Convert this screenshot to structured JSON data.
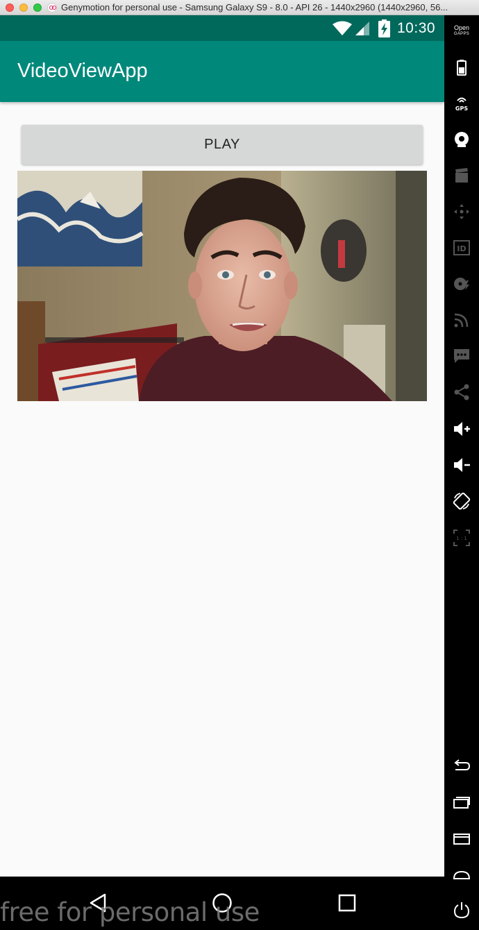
{
  "window": {
    "title": "Genymotion for personal use - Samsung Galaxy S9 - 8.0 - API 26 - 1440x2960 (1440x2960, 56..."
  },
  "status_bar": {
    "time": "10:30"
  },
  "app": {
    "title": "VideoViewApp",
    "play_button_label": "PLAY"
  },
  "watermark": "free for personal use",
  "toolbar": {
    "opengapps_line1": "Open",
    "opengapps_line2": "GAPPS",
    "gps_label": "GPS",
    "id_label": "ID",
    "pixel_perfect_label": "1 : 1"
  },
  "colors": {
    "status_bar": "#00695c",
    "action_bar": "#00897b",
    "content_background": "#fafafa",
    "button": "#d6d7d7"
  }
}
